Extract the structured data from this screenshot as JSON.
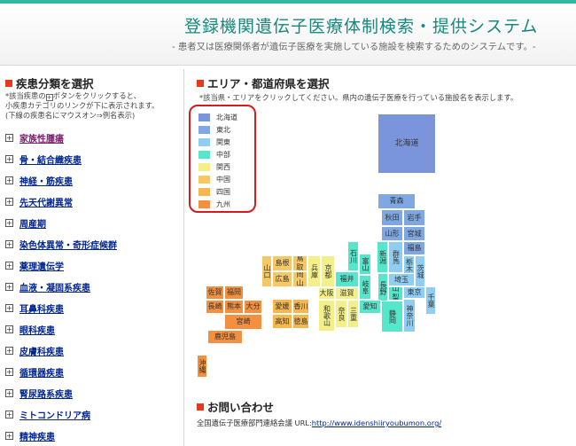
{
  "header": {
    "title": "登録機関遺伝子医療体制検索・提供システム",
    "subtitle": "- 患者又は医療関係者が遺伝子医療を実施している施設を検索するためのシステムです。-"
  },
  "left_panel": {
    "heading": "疾患分類を選択",
    "note_line1_pre": "*該当疾患の",
    "note_line1_post": "ボタンをクリックすると、",
    "note_line2": "小疾患カテゴリのリンクが下に表示されます。",
    "note_line3": "(下線の疾患名にマウスオン⇒例名表示)",
    "plus_icon": "⊞",
    "categories": [
      {
        "label": "家族性腫瘍"
      },
      {
        "label": "骨・結合織疾患"
      },
      {
        "label": "神経・筋疾患"
      },
      {
        "label": "先天代謝異常"
      },
      {
        "label": "周産期"
      },
      {
        "label": "染色体異常・奇形症候群"
      },
      {
        "label": "薬理遺伝学"
      },
      {
        "label": "血液・凝固系疾患"
      },
      {
        "label": "耳鼻科疾患"
      },
      {
        "label": "眼科疾患"
      },
      {
        "label": "皮膚科疾患"
      },
      {
        "label": "循環器疾患"
      },
      {
        "label": "腎尿路系疾患"
      },
      {
        "label": "ミトコンドリア病"
      },
      {
        "label": "精神疾患"
      }
    ]
  },
  "right_panel": {
    "heading": "エリア・都道府県を選択",
    "note": "*該当県・エリアをクリックしてください。県内の遺伝子医療を行っている施設名を表示します。",
    "legend": [
      {
        "label": "北海道",
        "color": "#7b95dc"
      },
      {
        "label": "東北",
        "color": "#7fa8e2"
      },
      {
        "label": "関東",
        "color": "#8fcdf2"
      },
      {
        "label": "中部",
        "color": "#55e6cc"
      },
      {
        "label": "関西",
        "color": "#f3f08a"
      },
      {
        "label": "中国",
        "color": "#f5c865"
      },
      {
        "label": "四国",
        "color": "#f5b850"
      },
      {
        "label": "九州",
        "color": "#f39040"
      }
    ],
    "prefectures": {
      "hokkaido": "北海道",
      "aomori": "青森",
      "akita": "秋田",
      "iwate": "岩手",
      "yamagata": "山形",
      "miyagi": "宮城",
      "fukushima": "福島",
      "niigata": "新潟",
      "gunma": "群馬",
      "tochigi": "栃木",
      "ibaraki": "茨城",
      "saitama": "埼玉",
      "tokyo": "東京",
      "chiba": "千葉",
      "kanagawa": "神奈川",
      "yamanashi": "山梨",
      "nagano": "長野",
      "shizuoka": "静岡",
      "toyama": "富山",
      "ishikawa": "石川",
      "fukui": "福井",
      "gifu": "岐阜",
      "aichi": "愛知",
      "shiga": "滋賀",
      "kyoto": "京都",
      "osaka": "大阪",
      "hyogo": "兵庫",
      "nara": "奈良",
      "mie": "三重",
      "wakayama": "和歌山",
      "tottori": "鳥取",
      "shimane": "島根",
      "okayama": "岡山",
      "hiroshima": "広島",
      "yamaguchi": "山口",
      "kagawa": "香川",
      "ehime": "愛媛",
      "tokushima": "徳島",
      "kochi": "高知",
      "fukuoka": "福岡",
      "saga": "佐賀",
      "nagasaki": "長崎",
      "kumamoto": "熊本",
      "oita": "大分",
      "miyazaki": "宮崎",
      "kagoshima": "鹿児島",
      "okinawa": "沖縄"
    }
  },
  "contact": {
    "heading": "お問い合わせ",
    "org": "全国遺伝子医療部門連絡会議 URL:",
    "url": "http://www.idenshiiryoubumon.org/"
  }
}
